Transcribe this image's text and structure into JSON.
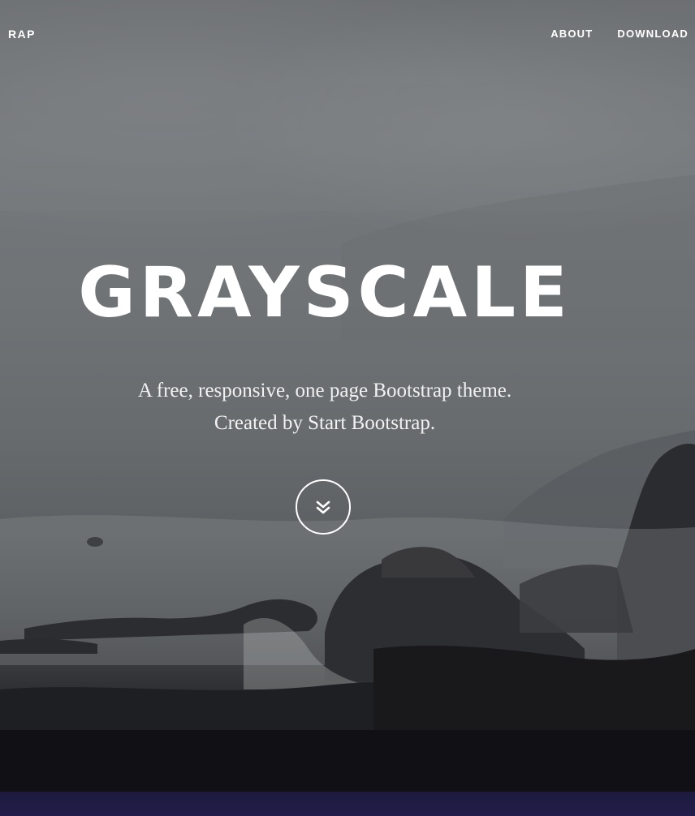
{
  "navbar": {
    "brand_visible": "RAP",
    "links": [
      {
        "label": "ABOUT"
      },
      {
        "label": "DOWNLOAD"
      }
    ]
  },
  "hero": {
    "title": "GRAYSCALE",
    "subtitle_line1": "A free, responsive, one page Bootstrap theme.",
    "subtitle_line2": "Created by Start Bootstrap.",
    "scroll_icon": "double-chevron-down-icon"
  },
  "colors": {
    "text": "#ffffff",
    "bottom_band": "#221d4a"
  }
}
